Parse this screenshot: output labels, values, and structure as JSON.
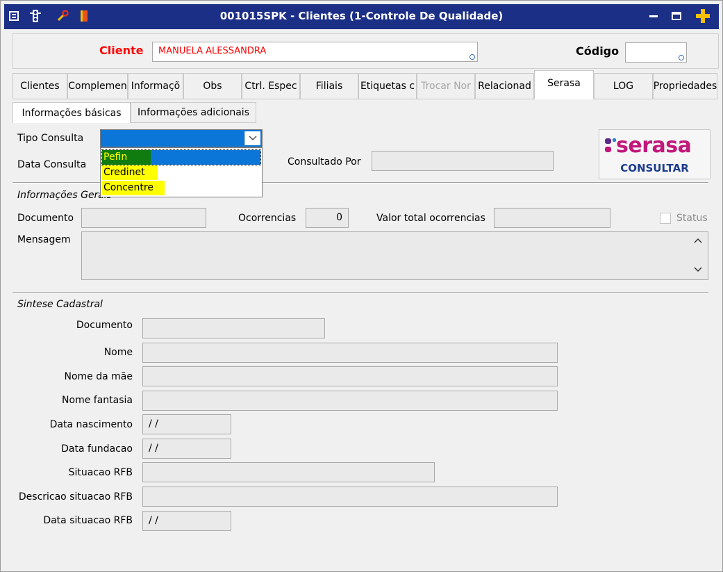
{
  "window": {
    "title": "001015SPK - Clientes (1-Controle De Qualidade)"
  },
  "header": {
    "cliente_label": "Cliente",
    "cliente_value": "MANUELA ALESSANDRA",
    "codigo_label": "Código",
    "codigo_value": ""
  },
  "tabs": [
    {
      "label": "Clientes"
    },
    {
      "label": "Complemen"
    },
    {
      "label": "Informaçõ"
    },
    {
      "label": "Obs"
    },
    {
      "label": "Ctrl. Espec"
    },
    {
      "label": "Filiais"
    },
    {
      "label": "Etiquetas c"
    },
    {
      "label": "Trocar Nor"
    },
    {
      "label": "Relacionad"
    },
    {
      "label": "Serasa"
    },
    {
      "label": "LOG"
    },
    {
      "label": "Propriedades"
    }
  ],
  "subtabs": [
    {
      "label": "Informações básicas"
    },
    {
      "label": "Informações adicionais"
    }
  ],
  "consulta": {
    "tipo_label": "Tipo Consulta",
    "tipo_value": "",
    "options": [
      "Pefin",
      "Credinet",
      "Concentre"
    ],
    "data_label": "Data Consulta",
    "consultado_label": "Consultado Por",
    "consultado_value": "",
    "serasa_logo": "serasa",
    "consultar_label": "CONSULTAR"
  },
  "gerais": {
    "section_title": "Informações Gerais",
    "documento_label": "Documento",
    "documento_value": "",
    "ocorrencias_label": "Ocorrencias",
    "ocorrencias_value": "0",
    "valor_total_label": "Valor total ocorrencias",
    "valor_total_value": "",
    "status_label": "Status",
    "mensagem_label": "Mensagem",
    "mensagem_value": ""
  },
  "sintese": {
    "section_title": "Sintese Cadastral",
    "fields": [
      {
        "label": "Documento",
        "value": ""
      },
      {
        "label": "Nome",
        "value": ""
      },
      {
        "label": "Nome da mãe",
        "value": ""
      },
      {
        "label": "Nome fantasia",
        "value": ""
      },
      {
        "label": "Data nascimento",
        "value": " / /"
      },
      {
        "label": "Data fundacao",
        "value": " / /"
      },
      {
        "label": "Situacao RFB",
        "value": ""
      },
      {
        "label": "Descricao situacao RFB",
        "value": ""
      },
      {
        "label": "Data situacao RFB",
        "value": " / /"
      }
    ]
  },
  "colors": {
    "titlebar": "#1c2f87",
    "required_label": "#ff0000",
    "dropdown_selected": "#0b76d8",
    "option_highlight": "#008000",
    "annotation_yellow": "#ffff00",
    "serasa_magenta": "#c1187b"
  }
}
